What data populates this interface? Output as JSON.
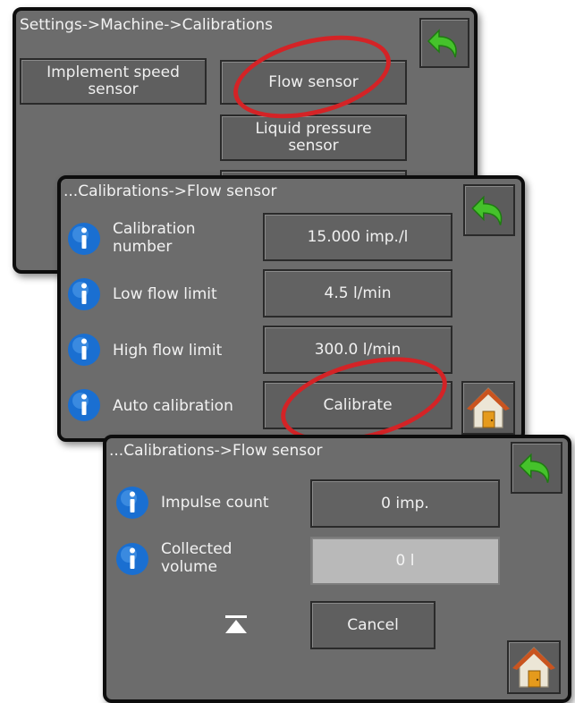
{
  "panel1": {
    "breadcrumb": "Settings->Machine->Calibrations",
    "implement_speed_label": "Implement speed sensor",
    "flow_sensor_label": "Flow sensor",
    "liquid_pressure_label": "Liquid pressure sensor",
    "back_icon": "back-arrow-icon"
  },
  "panel2": {
    "breadcrumb": "...Calibrations->Flow sensor",
    "rows": [
      {
        "label": "Calibration number",
        "value": "15.000 imp./l"
      },
      {
        "label": "Low flow limit",
        "value": "4.5 l/min"
      },
      {
        "label": "High flow limit",
        "value": "300.0 l/min"
      },
      {
        "label": "Auto calibration",
        "value": "Calibrate"
      }
    ],
    "back_icon": "back-arrow-icon",
    "home_icon": "home-icon"
  },
  "panel3": {
    "breadcrumb": "...Calibrations->Flow sensor",
    "rows": [
      {
        "label": "Impulse count",
        "value": "0 imp."
      },
      {
        "label": "Collected volume",
        "value": "0 l"
      }
    ],
    "cancel_label": "Cancel",
    "back_icon": "back-arrow-icon",
    "home_icon": "home-icon"
  },
  "colors": {
    "panel_bg": "#6c6c6c",
    "highlight_ellipse": "#d42326",
    "info_icon": "#1a6fd1",
    "back_arrow": "#45c22b"
  }
}
